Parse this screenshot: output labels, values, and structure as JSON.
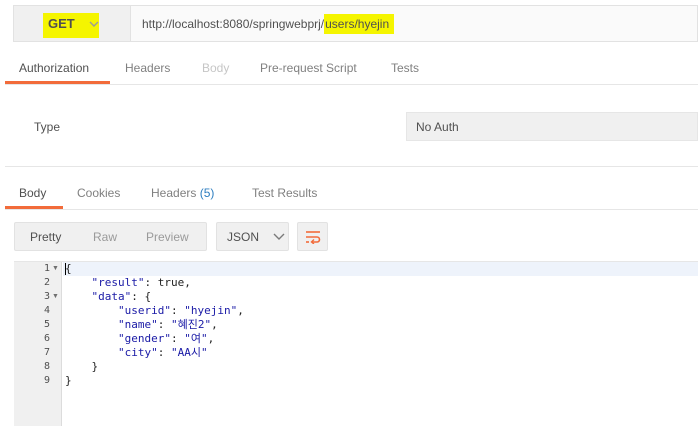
{
  "request": {
    "method": "GET",
    "url_base": "http://localhost:8080/springwebprj/",
    "url_path": "users/hyejin",
    "highlight_color": "#f5f500"
  },
  "request_tabs": [
    "Authorization",
    "Headers",
    "Body",
    "Pre-request Script",
    "Tests"
  ],
  "auth": {
    "type_label": "Type",
    "type_value": "No Auth"
  },
  "response_tabs": {
    "body": "Body",
    "cookies": "Cookies",
    "headers": "Headers",
    "headers_count": "(5)",
    "test_results": "Test Results"
  },
  "response_view": {
    "modes": [
      "Pretty",
      "Raw",
      "Preview"
    ],
    "format": "JSON",
    "wrap_icon": "wrap-lines-icon"
  },
  "code": {
    "line_numbers": [
      "1",
      "2",
      "3",
      "4",
      "5",
      "6",
      "7",
      "8",
      "9"
    ],
    "lines": [
      "{",
      "    \"result\": true,",
      "    \"data\": {",
      "        \"userid\": \"hyejin\",",
      "        \"name\": \"혜진2\",",
      "        \"gender\": \"여\",",
      "        \"city\": \"AA시\"",
      "    }",
      "}"
    ]
  },
  "accent_color": "#f26b3a",
  "count_color": "#2d7ec0"
}
